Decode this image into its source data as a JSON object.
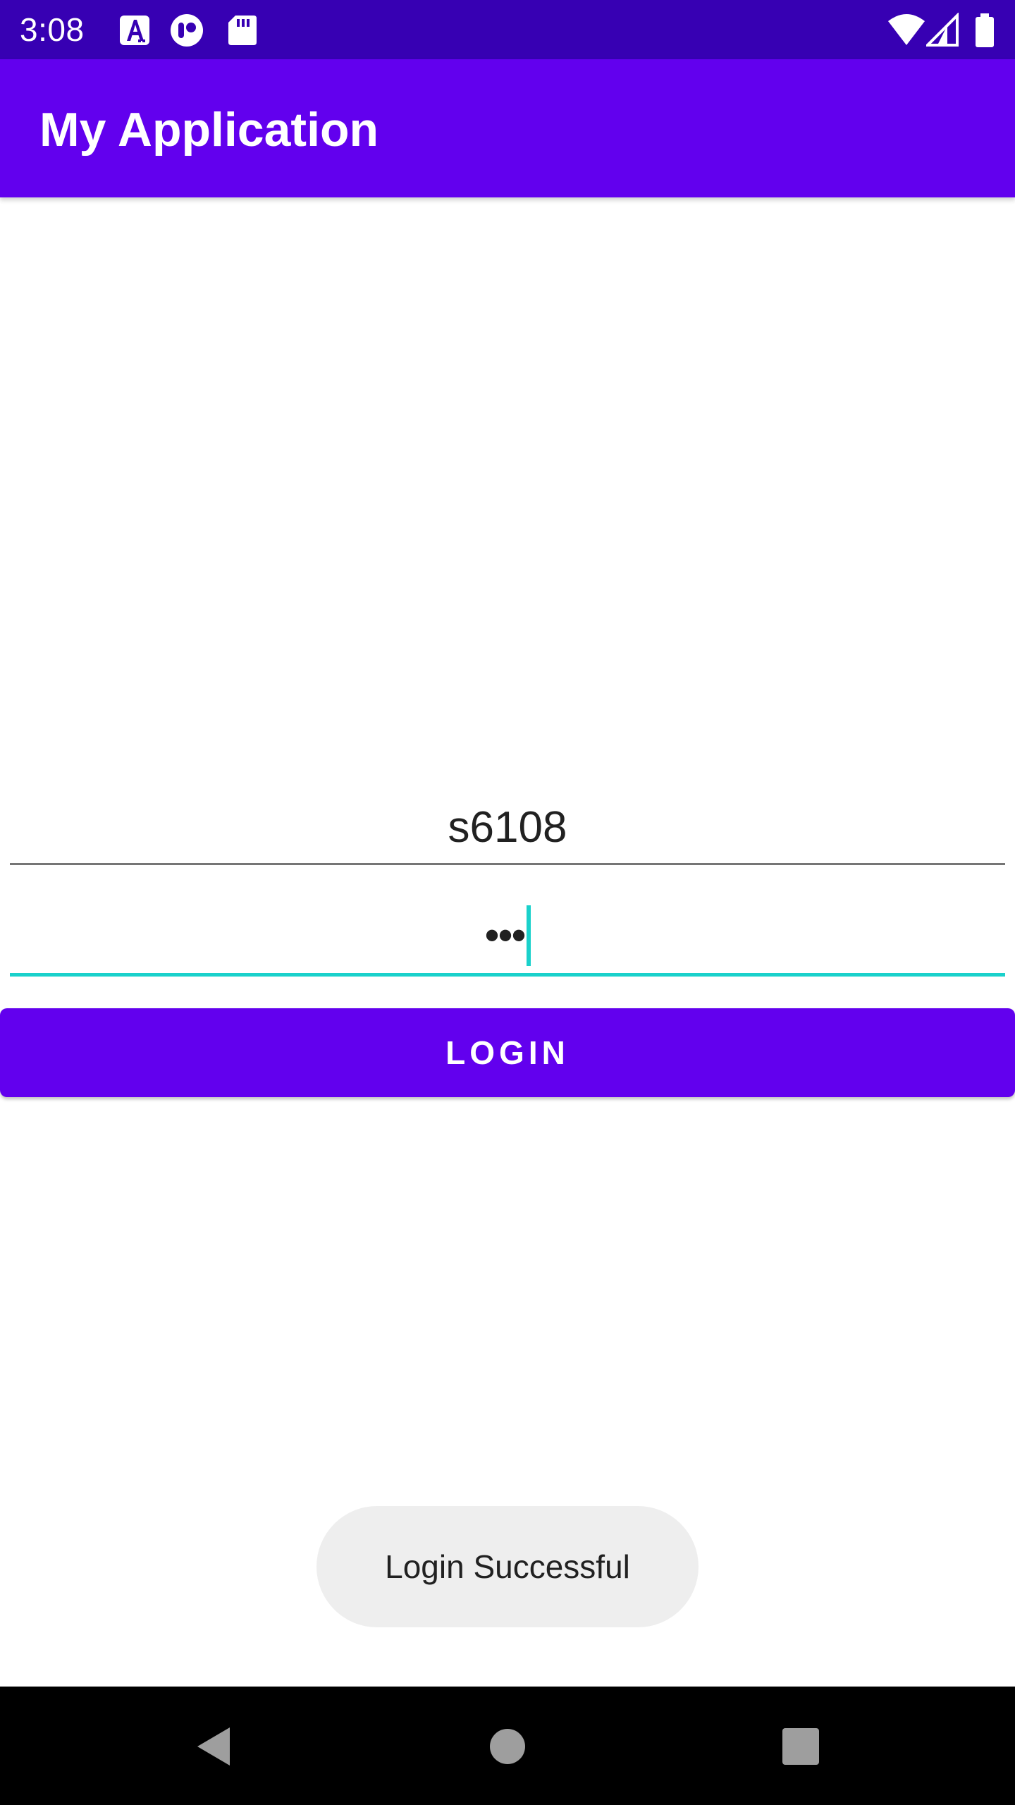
{
  "status_bar": {
    "time": "3:08",
    "notification_icons": [
      "text-a-icon",
      "media-app-icon",
      "sd-card-icon"
    ],
    "system_icons": [
      "wifi-icon",
      "cellular-signal-icon",
      "battery-icon"
    ],
    "color": "#3700b3"
  },
  "app_bar": {
    "title": "My Application",
    "color": "#6200ee"
  },
  "form": {
    "username_value": "s6108",
    "password_value": "•••",
    "focused_field": "password",
    "accent_color": "#1ad1cb"
  },
  "login_button": {
    "label": "LOGIN",
    "color": "#6200ee"
  },
  "toast": {
    "message": "Login Successful"
  },
  "navigation_bar": {
    "buttons": [
      "back-icon",
      "home-icon",
      "recents-icon"
    ]
  }
}
